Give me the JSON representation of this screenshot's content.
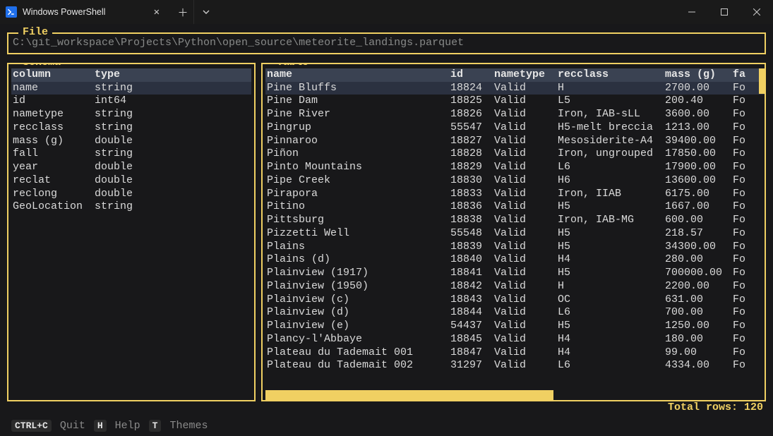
{
  "window": {
    "tab_title": "Windows PowerShell"
  },
  "file": {
    "legend": "File",
    "path": "C:\\git_workspace\\Projects\\Python\\open_source\\meteorite_landings.parquet"
  },
  "schema": {
    "legend": "Schema",
    "header": {
      "col1": "column",
      "col2": "type"
    },
    "rows": [
      {
        "col": "name",
        "type": "string",
        "selected": true
      },
      {
        "col": "id",
        "type": "int64"
      },
      {
        "col": "nametype",
        "type": "string"
      },
      {
        "col": "recclass",
        "type": "string"
      },
      {
        "col": "mass (g)",
        "type": "double"
      },
      {
        "col": "fall",
        "type": "string"
      },
      {
        "col": "year",
        "type": "double"
      },
      {
        "col": "reclat",
        "type": "double"
      },
      {
        "col": "reclong",
        "type": "double"
      },
      {
        "col": "GeoLocation",
        "type": "string"
      }
    ]
  },
  "table": {
    "legend": "Table",
    "header": [
      "name",
      "id",
      "nametype",
      "recclass",
      "mass (g)",
      "fa"
    ],
    "rows": [
      {
        "c": [
          "Pine Bluffs",
          "18824",
          "Valid",
          "H",
          "2700.00",
          "Fo"
        ],
        "selected": true
      },
      {
        "c": [
          "Pine Dam",
          "18825",
          "Valid",
          "L5",
          "200.40",
          "Fo"
        ]
      },
      {
        "c": [
          "Pine River",
          "18826",
          "Valid",
          "Iron, IAB-sLL",
          "3600.00",
          "Fo"
        ]
      },
      {
        "c": [
          "Pingrup",
          "55547",
          "Valid",
          "H5-melt breccia",
          "1213.00",
          "Fo"
        ]
      },
      {
        "c": [
          "Pinnaroo",
          "18827",
          "Valid",
          "Mesosiderite-A4",
          "39400.00",
          "Fo"
        ]
      },
      {
        "c": [
          "Piñon",
          "18828",
          "Valid",
          "Iron, ungrouped",
          "17850.00",
          "Fo"
        ]
      },
      {
        "c": [
          "Pinto Mountains",
          "18829",
          "Valid",
          "L6",
          "17900.00",
          "Fo"
        ]
      },
      {
        "c": [
          "Pipe Creek",
          "18830",
          "Valid",
          "H6",
          "13600.00",
          "Fo"
        ]
      },
      {
        "c": [
          "Pirapora",
          "18833",
          "Valid",
          "Iron, IIAB",
          "6175.00",
          "Fo"
        ]
      },
      {
        "c": [
          "Pitino",
          "18836",
          "Valid",
          "H5",
          "1667.00",
          "Fo"
        ]
      },
      {
        "c": [
          "Pittsburg",
          "18838",
          "Valid",
          "Iron, IAB-MG",
          "600.00",
          "Fo"
        ]
      },
      {
        "c": [
          "Pizzetti Well",
          "55548",
          "Valid",
          "H5",
          "218.57",
          "Fo"
        ]
      },
      {
        "c": [
          "Plains",
          "18839",
          "Valid",
          "H5",
          "34300.00",
          "Fo"
        ]
      },
      {
        "c": [
          "Plains (d)",
          "18840",
          "Valid",
          "H4",
          "280.00",
          "Fo"
        ]
      },
      {
        "c": [
          "Plainview (1917)",
          "18841",
          "Valid",
          "H5",
          "700000.00",
          "Fo"
        ]
      },
      {
        "c": [
          "Plainview (1950)",
          "18842",
          "Valid",
          "H",
          "2200.00",
          "Fo"
        ]
      },
      {
        "c": [
          "Plainview (c)",
          "18843",
          "Valid",
          "OC",
          "631.00",
          "Fo"
        ]
      },
      {
        "c": [
          "Plainview (d)",
          "18844",
          "Valid",
          "L6",
          "700.00",
          "Fo"
        ]
      },
      {
        "c": [
          "Plainview (e)",
          "54437",
          "Valid",
          "H5",
          "1250.00",
          "Fo"
        ]
      },
      {
        "c": [
          "Plancy-l'Abbaye",
          "18845",
          "Valid",
          "H4",
          "180.00",
          "Fo"
        ]
      },
      {
        "c": [
          "Plateau du Tademait 001",
          "18847",
          "Valid",
          "H4",
          "99.00",
          "Fo"
        ]
      },
      {
        "c": [
          "Plateau du Tademait 002",
          "31297",
          "Valid",
          "L6",
          "4334.00",
          "Fo"
        ]
      }
    ],
    "total_rows_label": "Total rows: 120"
  },
  "footer": {
    "ctrl_c": "CTRL+C",
    "quit": "Quit",
    "h": "H",
    "help": "Help",
    "t": "T",
    "themes": "Themes"
  }
}
